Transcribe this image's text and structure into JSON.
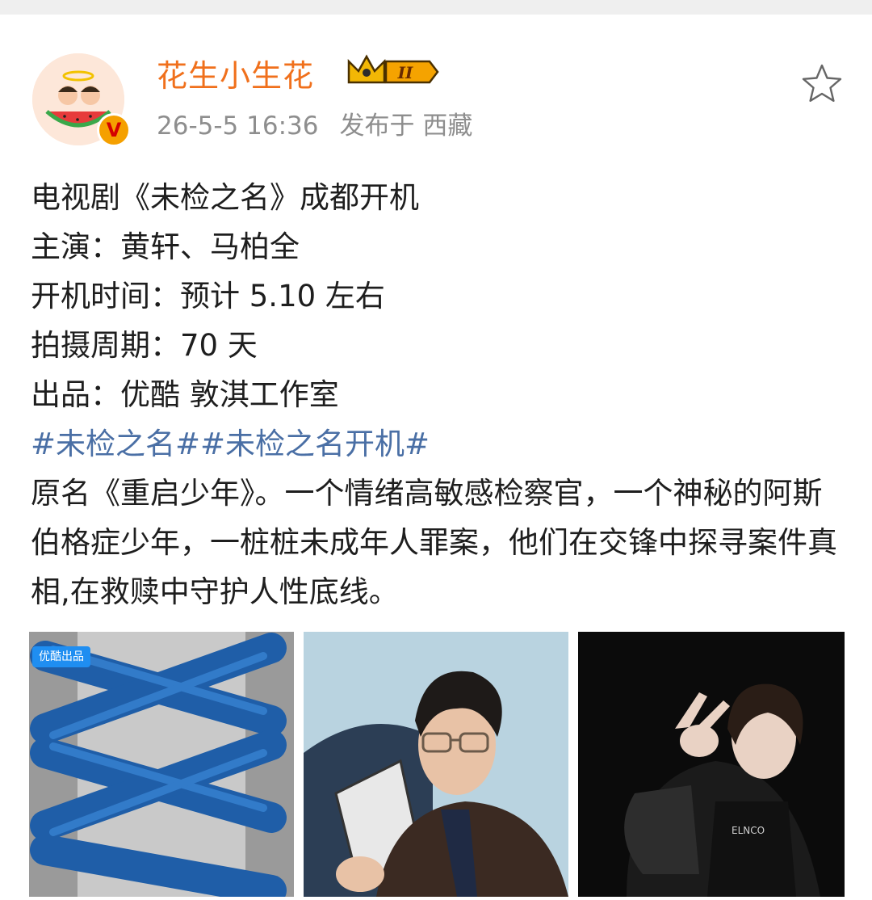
{
  "post": {
    "username": "花生小生花",
    "level_badge": "II",
    "time": "26-5-5 16:36",
    "location": "发布于 西藏",
    "content_lines": [
      "电视剧《未检之名》成都开机",
      "主演：黄轩、马柏全",
      "开机时间：预计 5.10 左右",
      "拍摄周期：70 天",
      "出品：优酷 敦淇工作室"
    ],
    "hashtags": [
      "#未检之名#",
      "#未检之名开机#"
    ],
    "description": "原名《重启少年》。一个情绪高敏感检察官，一个神秘的阿斯伯格症少年，一桩桩未成年人罪案，他们在交锋中探寻案件真相,在救赎中守护人性底线。"
  },
  "images": {
    "tag": "优酷出品",
    "photo_1": "poster-shoelace",
    "photo_2": "actor-portrait-glasses",
    "photo_3": "actor-portrait-peace-sign"
  },
  "icons": {
    "verified": "V",
    "favorite": "star-icon",
    "crown": "crown-icon"
  },
  "colors": {
    "username": "#f0701c",
    "hashtag": "#4a6fa5",
    "meta": "#8e8e8e"
  }
}
